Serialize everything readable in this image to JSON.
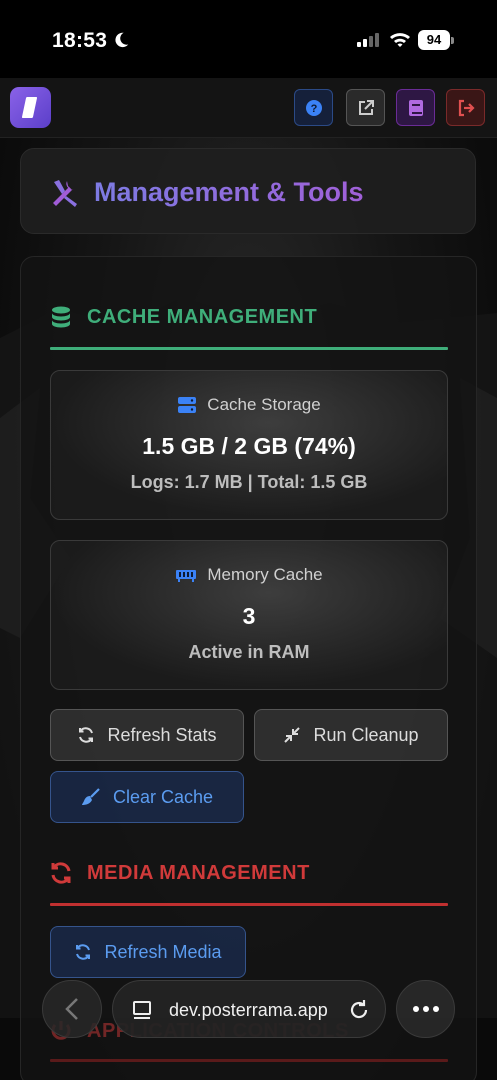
{
  "status_bar": {
    "time": "18:53",
    "battery": "94"
  },
  "top_nav": {
    "buttons": [
      {
        "icon": "help-icon",
        "color": "#3b82f6"
      },
      {
        "icon": "external-link-icon",
        "color": "#cccccc"
      },
      {
        "icon": "book-icon",
        "color": "#b06ae0"
      },
      {
        "icon": "logout-icon",
        "color": "#e05050"
      }
    ]
  },
  "header": {
    "title": "Management & Tools",
    "icon": "tools-icon"
  },
  "cache_section": {
    "title": "CACHE MANAGEMENT",
    "color": "#3fae7a",
    "storage_card": {
      "label": "Cache Storage",
      "value": "1.5 GB / 2 GB (74%)",
      "detail": "Logs: 1.7 MB | Total: 1.5 GB"
    },
    "memory_card": {
      "label": "Memory Cache",
      "value": "3",
      "detail": "Active in RAM"
    },
    "buttons": {
      "refresh": "Refresh Stats",
      "cleanup": "Run Cleanup",
      "clear": "Clear Cache"
    }
  },
  "media_section": {
    "title": "MEDIA MANAGEMENT",
    "color": "#d03a3a",
    "buttons": {
      "refresh": "Refresh Media"
    }
  },
  "next_section": {
    "title": "APPLICATION CONTROLS"
  },
  "browser": {
    "url": "dev.posterrama.app"
  }
}
